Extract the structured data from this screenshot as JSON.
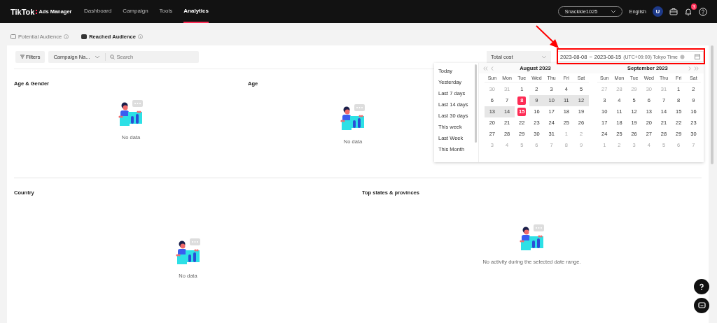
{
  "header": {
    "logo": "TikTok",
    "logo_sub": "Ads Manager",
    "nav": [
      {
        "label": "Dashboard",
        "selected": false
      },
      {
        "label": "Campaign",
        "selected": false
      },
      {
        "label": "Tools",
        "selected": false
      },
      {
        "label": "Analytics",
        "selected": true
      }
    ],
    "account": "Snackkie1025",
    "language": "English",
    "avatar": "U",
    "notification_count": "3"
  },
  "audience_tabs": [
    {
      "label": "Potential Audience",
      "selected": false
    },
    {
      "label": "Reached Audience",
      "selected": true
    }
  ],
  "toolbar": {
    "filters": "Filters",
    "group_select": "Campaign Na...",
    "search_placeholder": "Search",
    "metric_select": "Total cost",
    "date_range": {
      "start": "2023-08-08",
      "separator": "~",
      "end": "2023-08-15",
      "timezone": "(UTC+09:00) Tokyo Time"
    }
  },
  "date_picker": {
    "presets": [
      "Today",
      "Yesterday",
      "Last 7 days",
      "Last 14 days",
      "Last 30 days",
      "This week",
      "Last Week",
      "This Month"
    ],
    "months": [
      {
        "title": "August 2023",
        "weekdays": [
          "Sun",
          "Mon",
          "Tue",
          "Wed",
          "Thu",
          "Fri",
          "Sat"
        ],
        "weeks": [
          [
            {
              "day": "30",
              "outside": true,
              "selected": false,
              "in_range": false
            },
            {
              "day": "31",
              "outside": true,
              "selected": false,
              "in_range": false
            },
            {
              "day": "1",
              "outside": false,
              "selected": false,
              "in_range": false
            },
            {
              "day": "2",
              "outside": false,
              "selected": false,
              "in_range": false
            },
            {
              "day": "3",
              "outside": false,
              "selected": false,
              "in_range": false
            },
            {
              "day": "4",
              "outside": false,
              "selected": false,
              "in_range": false
            },
            {
              "day": "5",
              "outside": false,
              "selected": false,
              "in_range": false
            }
          ],
          [
            {
              "day": "6",
              "outside": false,
              "selected": false,
              "in_range": false
            },
            {
              "day": "7",
              "outside": false,
              "selected": false,
              "in_range": false
            },
            {
              "day": "8",
              "outside": false,
              "selected": true,
              "in_range": false
            },
            {
              "day": "9",
              "outside": false,
              "selected": false,
              "in_range": true
            },
            {
              "day": "10",
              "outside": false,
              "selected": false,
              "in_range": true
            },
            {
              "day": "11",
              "outside": false,
              "selected": false,
              "in_range": true
            },
            {
              "day": "12",
              "outside": false,
              "selected": false,
              "in_range": true
            }
          ],
          [
            {
              "day": "13",
              "outside": false,
              "selected": false,
              "in_range": true
            },
            {
              "day": "14",
              "outside": false,
              "selected": false,
              "in_range": true
            },
            {
              "day": "15",
              "outside": false,
              "selected": true,
              "in_range": false
            },
            {
              "day": "16",
              "outside": false,
              "selected": false,
              "in_range": false
            },
            {
              "day": "17",
              "outside": false,
              "selected": false,
              "in_range": false
            },
            {
              "day": "18",
              "outside": false,
              "selected": false,
              "in_range": false
            },
            {
              "day": "19",
              "outside": false,
              "selected": false,
              "in_range": false
            }
          ],
          [
            {
              "day": "20",
              "outside": false,
              "selected": false,
              "in_range": false
            },
            {
              "day": "21",
              "outside": false,
              "selected": false,
              "in_range": false
            },
            {
              "day": "22",
              "outside": false,
              "selected": false,
              "in_range": false
            },
            {
              "day": "23",
              "outside": false,
              "selected": false,
              "in_range": false
            },
            {
              "day": "24",
              "outside": false,
              "selected": false,
              "in_range": false
            },
            {
              "day": "25",
              "outside": false,
              "selected": false,
              "in_range": false
            },
            {
              "day": "26",
              "outside": false,
              "selected": false,
              "in_range": false
            }
          ],
          [
            {
              "day": "27",
              "outside": false,
              "selected": false,
              "in_range": false
            },
            {
              "day": "28",
              "outside": false,
              "selected": false,
              "in_range": false
            },
            {
              "day": "29",
              "outside": false,
              "selected": false,
              "in_range": false
            },
            {
              "day": "30",
              "outside": false,
              "selected": false,
              "in_range": false
            },
            {
              "day": "31",
              "outside": false,
              "selected": false,
              "in_range": false
            },
            {
              "day": "1",
              "outside": true,
              "selected": false,
              "in_range": false
            },
            {
              "day": "2",
              "outside": true,
              "selected": false,
              "in_range": false
            }
          ],
          [
            {
              "day": "3",
              "outside": true,
              "selected": false,
              "in_range": false
            },
            {
              "day": "4",
              "outside": true,
              "selected": false,
              "in_range": false
            },
            {
              "day": "5",
              "outside": true,
              "selected": false,
              "in_range": false
            },
            {
              "day": "6",
              "outside": true,
              "selected": false,
              "in_range": false
            },
            {
              "day": "7",
              "outside": true,
              "selected": false,
              "in_range": false
            },
            {
              "day": "8",
              "outside": true,
              "selected": false,
              "in_range": false
            },
            {
              "day": "9",
              "outside": true,
              "selected": false,
              "in_range": false
            }
          ]
        ]
      },
      {
        "title": "September 2023",
        "weekdays": [
          "Sun",
          "Mon",
          "Tue",
          "Wed",
          "Thu",
          "Fri",
          "Sat"
        ],
        "weeks": [
          [
            {
              "day": "27",
              "outside": true,
              "selected": false,
              "in_range": false
            },
            {
              "day": "28",
              "outside": true,
              "selected": false,
              "in_range": false
            },
            {
              "day": "29",
              "outside": true,
              "selected": false,
              "in_range": false
            },
            {
              "day": "30",
              "outside": true,
              "selected": false,
              "in_range": false
            },
            {
              "day": "31",
              "outside": true,
              "selected": false,
              "in_range": false
            },
            {
              "day": "1",
              "outside": false,
              "selected": false,
              "in_range": false
            },
            {
              "day": "2",
              "outside": false,
              "selected": false,
              "in_range": false
            }
          ],
          [
            {
              "day": "3",
              "outside": false,
              "selected": false,
              "in_range": false
            },
            {
              "day": "4",
              "outside": false,
              "selected": false,
              "in_range": false
            },
            {
              "day": "5",
              "outside": false,
              "selected": false,
              "in_range": false
            },
            {
              "day": "6",
              "outside": false,
              "selected": false,
              "in_range": false
            },
            {
              "day": "7",
              "outside": false,
              "selected": false,
              "in_range": false
            },
            {
              "day": "8",
              "outside": false,
              "selected": false,
              "in_range": false
            },
            {
              "day": "9",
              "outside": false,
              "selected": false,
              "in_range": false
            }
          ],
          [
            {
              "day": "10",
              "outside": false,
              "selected": false,
              "in_range": false
            },
            {
              "day": "11",
              "outside": false,
              "selected": false,
              "in_range": false
            },
            {
              "day": "12",
              "outside": false,
              "selected": false,
              "in_range": false
            },
            {
              "day": "13",
              "outside": false,
              "selected": false,
              "in_range": false
            },
            {
              "day": "14",
              "outside": false,
              "selected": false,
              "in_range": false
            },
            {
              "day": "15",
              "outside": false,
              "selected": false,
              "in_range": false
            },
            {
              "day": "16",
              "outside": false,
              "selected": false,
              "in_range": false
            }
          ],
          [
            {
              "day": "17",
              "outside": false,
              "selected": false,
              "in_range": false
            },
            {
              "day": "18",
              "outside": false,
              "selected": false,
              "in_range": false
            },
            {
              "day": "19",
              "outside": false,
              "selected": false,
              "in_range": false
            },
            {
              "day": "20",
              "outside": false,
              "selected": false,
              "in_range": false
            },
            {
              "day": "21",
              "outside": false,
              "selected": false,
              "in_range": false
            },
            {
              "day": "22",
              "outside": false,
              "selected": false,
              "in_range": false
            },
            {
              "day": "23",
              "outside": false,
              "selected": false,
              "in_range": false
            }
          ],
          [
            {
              "day": "24",
              "outside": false,
              "selected": false,
              "in_range": false
            },
            {
              "day": "25",
              "outside": false,
              "selected": false,
              "in_range": false
            },
            {
              "day": "26",
              "outside": false,
              "selected": false,
              "in_range": false
            },
            {
              "day": "27",
              "outside": false,
              "selected": false,
              "in_range": false
            },
            {
              "day": "28",
              "outside": false,
              "selected": false,
              "in_range": false
            },
            {
              "day": "29",
              "outside": false,
              "selected": false,
              "in_range": false
            },
            {
              "day": "30",
              "outside": false,
              "selected": false,
              "in_range": false
            }
          ],
          [
            {
              "day": "1",
              "outside": true,
              "selected": false,
              "in_range": false
            },
            {
              "day": "2",
              "outside": true,
              "selected": false,
              "in_range": false
            },
            {
              "day": "3",
              "outside": true,
              "selected": false,
              "in_range": false
            },
            {
              "day": "4",
              "outside": true,
              "selected": false,
              "in_range": false
            },
            {
              "day": "5",
              "outside": true,
              "selected": false,
              "in_range": false
            },
            {
              "day": "6",
              "outside": true,
              "selected": false,
              "in_range": false
            },
            {
              "day": "7",
              "outside": true,
              "selected": false,
              "in_range": false
            }
          ]
        ]
      }
    ]
  },
  "sections_top": [
    {
      "title": "Age & Gender",
      "empty_text": "No data"
    },
    {
      "title": "Age",
      "empty_text": "No data"
    }
  ],
  "sections_bottom": [
    {
      "title": "Country",
      "empty_text": "No data"
    },
    {
      "title": "Top states & provinces",
      "empty_text": "No activity during the selected date range."
    }
  ]
}
